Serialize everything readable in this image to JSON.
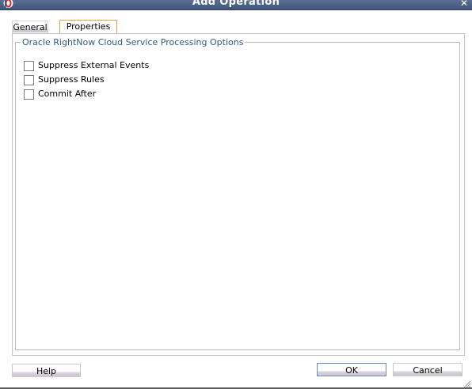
{
  "window": {
    "title": "Add Operation",
    "close_label": "✕"
  },
  "tabs": [
    {
      "label": "General",
      "selected": false
    },
    {
      "label": "Properties",
      "selected": true
    }
  ],
  "group": {
    "legend": "Oracle RightNow Cloud Service Processing Options",
    "options": [
      {
        "label": "Suppress External Events",
        "checked": false
      },
      {
        "label": "Suppress Rules",
        "checked": false
      },
      {
        "label": "Commit After",
        "checked": false
      }
    ]
  },
  "buttons": {
    "help": "Help",
    "ok": "OK",
    "cancel": "Cancel"
  },
  "colors": {
    "titlebar": "#4a5f86",
    "legend_text": "#2d5b8a",
    "selected_tab_border": "#e8a540"
  }
}
